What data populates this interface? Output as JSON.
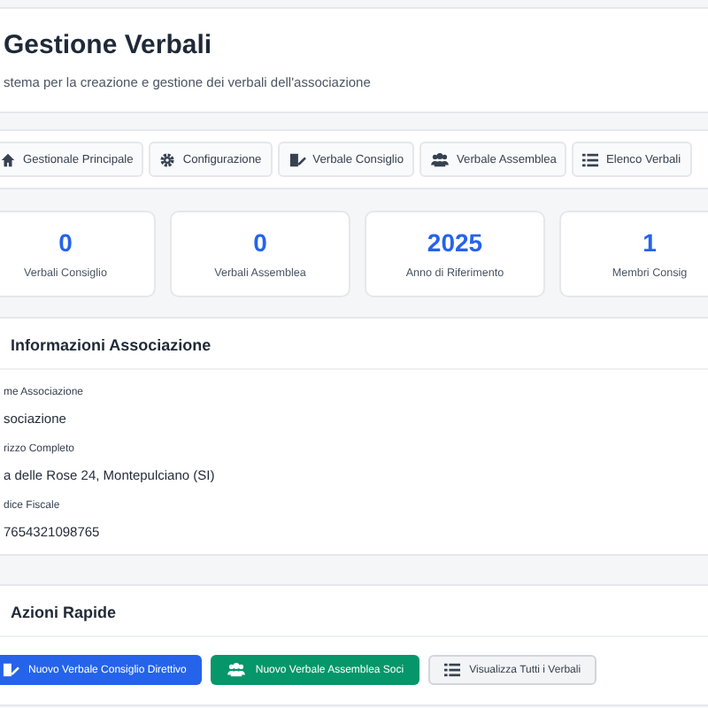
{
  "header": {
    "title": "Gestione Verbali",
    "subtitle": "stema per la creazione e gestione dei verbali dell'associazione"
  },
  "nav": [
    {
      "label": "Gestionale Principale"
    },
    {
      "label": "Configurazione"
    },
    {
      "label": "Verbale Consiglio"
    },
    {
      "label": "Verbale Assemblea"
    },
    {
      "label": "Elenco Verbali"
    }
  ],
  "stats": [
    {
      "value": "0",
      "label": "Verbali Consiglio"
    },
    {
      "value": "0",
      "label": "Verbali Assemblea"
    },
    {
      "value": "2025",
      "label": "Anno di Riferimento"
    },
    {
      "value": "1",
      "label": "Membri Consig"
    }
  ],
  "info": {
    "title": "Informazioni Associazione",
    "fields": [
      {
        "label": "me Associazione",
        "value": "sociazione"
      },
      {
        "label": "rizzo Completo",
        "value": "a delle Rose 24, Montepulciano (SI)"
      },
      {
        "label": "dice Fiscale",
        "value": "7654321098765"
      }
    ]
  },
  "actions": {
    "title": "Azioni Rapide",
    "buttons": [
      {
        "label": "Nuovo Verbale Consiglio Direttivo",
        "kind": "primary"
      },
      {
        "label": "Nuovo Verbale Assemblea Soci",
        "kind": "success"
      },
      {
        "label": "Visualizza Tutti i Verbali",
        "kind": "secondary"
      }
    ]
  }
}
